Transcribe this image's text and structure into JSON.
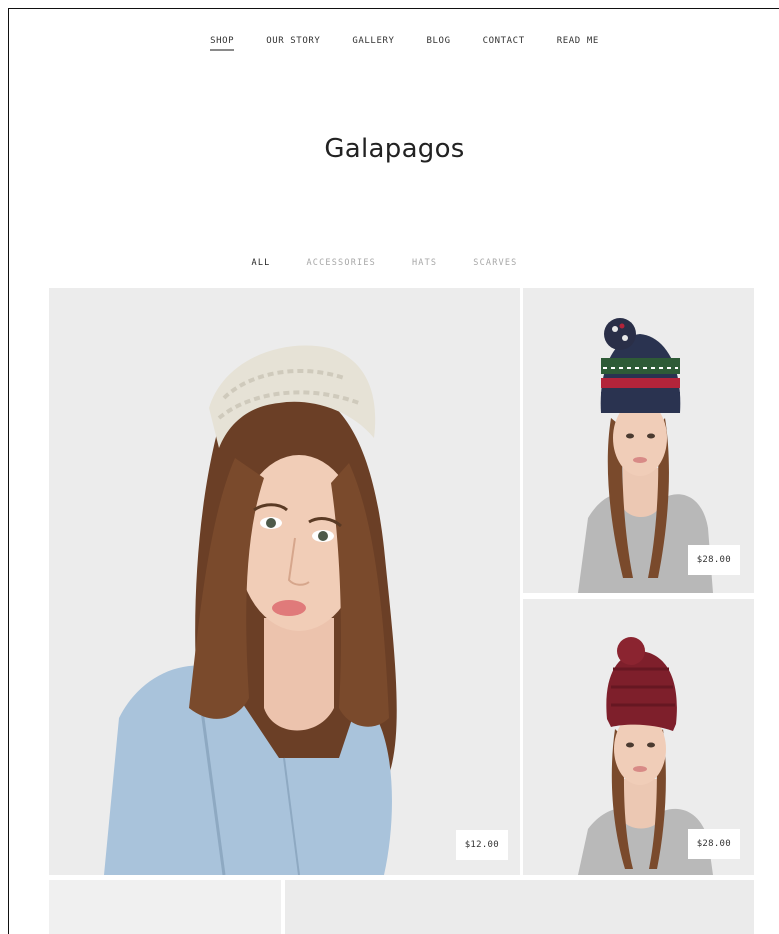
{
  "nav": {
    "items": [
      {
        "label": "SHOP",
        "active": true
      },
      {
        "label": "OUR STORY",
        "active": false
      },
      {
        "label": "GALLERY",
        "active": false
      },
      {
        "label": "BLOG",
        "active": false
      },
      {
        "label": "CONTACT",
        "active": false
      },
      {
        "label": "READ ME",
        "active": false
      }
    ]
  },
  "site": {
    "title": "Galapagos"
  },
  "filters": {
    "items": [
      {
        "label": "ALL",
        "active": true
      },
      {
        "label": "ACCESSORIES",
        "active": false
      },
      {
        "label": "HATS",
        "active": false
      },
      {
        "label": "SCARVES",
        "active": false
      }
    ]
  },
  "products": [
    {
      "price": "$12.00",
      "image": "woman-knit-headband"
    },
    {
      "price": "$28.00",
      "image": "woman-fair-isle-pompom-beanie"
    },
    {
      "price": "$28.00",
      "image": "woman-burgundy-pompom-beanie"
    }
  ],
  "colors": {
    "tile_bg": "#ececec",
    "text": "#222222",
    "muted": "#a7a7a7"
  }
}
